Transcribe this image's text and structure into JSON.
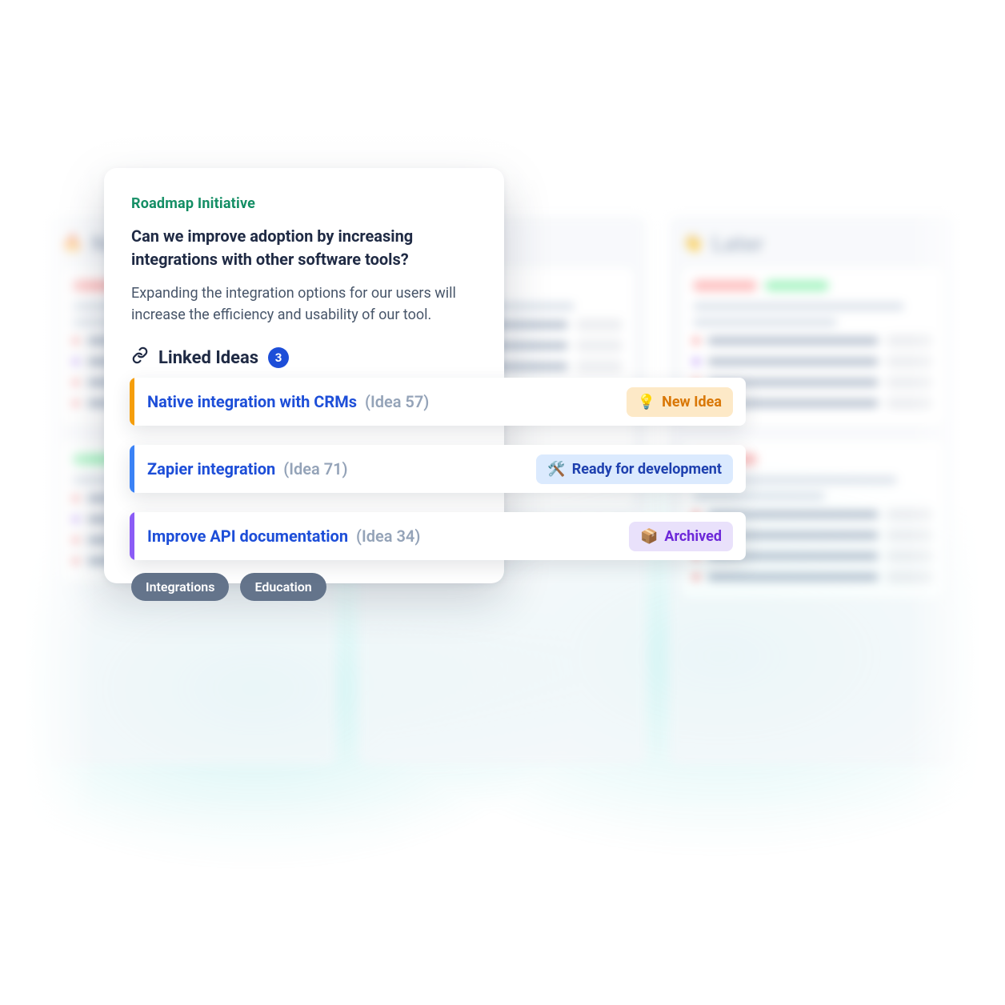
{
  "modal": {
    "eyebrow": "Roadmap Initiative",
    "question": "Can we improve adoption by increasing integrations with other software tools?",
    "description": "Expanding the integration options for our users will increase the efficiency and usability of our tool.",
    "linked_title": "Linked Ideas",
    "linked_count": "3",
    "ideas": [
      {
        "title": "Native integration with CRMs",
        "id": "(Idea 57)",
        "status_icon": "💡",
        "status": "New Idea",
        "variant": "new",
        "accent": "y"
      },
      {
        "title": "Zapier integration",
        "id": "(Idea 71)",
        "status_icon": "🛠️",
        "status": "Ready for development",
        "variant": "ready",
        "accent": "b"
      },
      {
        "title": "Improve API documentation",
        "id": "(Idea 34)",
        "status_icon": "📦",
        "status": "Archived",
        "variant": "arch",
        "accent": "v"
      }
    ],
    "tags": [
      "Integrations",
      "Education"
    ]
  },
  "background": {
    "later_title": "Later"
  }
}
